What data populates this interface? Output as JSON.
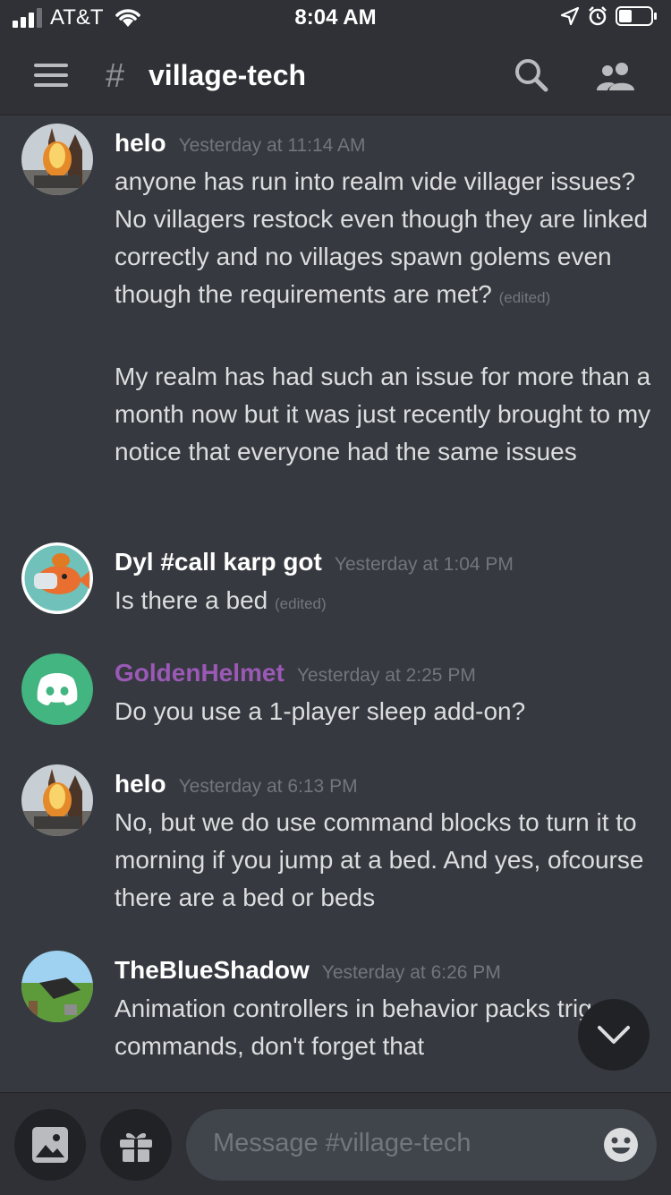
{
  "status_bar": {
    "carrier": "AT&T",
    "time": "8:04 AM"
  },
  "header": {
    "hash": "#",
    "channel_name": "village-tech"
  },
  "messages": [
    {
      "author": "helo",
      "timestamp": "Yesterday at 11:14 AM",
      "paragraphs": [
        {
          "text": "anyone has run into realm vide villager issues? No villagers restock even though they are linked correctly and no villages spawn golems even though the requirements are met?",
          "edited": "(edited)"
        },
        {
          "text": "My realm has had such an issue for more than a month now but it was just recently brought to my notice that everyone had the same issues"
        }
      ]
    },
    {
      "author": "Dyl #call karp got",
      "timestamp": "Yesterday at 1:04 PM",
      "paragraphs": [
        {
          "text": "Is there a bed",
          "edited": "(edited)"
        }
      ]
    },
    {
      "author": "GoldenHelmet",
      "timestamp": "Yesterday at 2:25 PM",
      "author_color": "#9b59b6",
      "paragraphs": [
        {
          "text": "Do you use a 1-player sleep add-on?"
        }
      ]
    },
    {
      "author": "helo",
      "timestamp": "Yesterday at 6:13 PM",
      "paragraphs": [
        {
          "text": "No, but we do use command blocks to turn it to morning if you jump at a bed. And yes, ofcourse there are a bed or beds"
        }
      ]
    },
    {
      "author": "TheBlueShadow",
      "timestamp": "Yesterday at 6:26 PM",
      "paragraphs": [
        {
          "text": "Animation controllers in behavior packs trigger commands, don't forget that"
        }
      ]
    }
  ],
  "composer": {
    "placeholder": "Message #village-tech"
  },
  "icons": [
    "signal-icon",
    "wifi-icon",
    "location-icon",
    "alarm-icon",
    "battery-icon",
    "menu-icon",
    "search-icon",
    "members-icon",
    "image-icon",
    "gift-icon",
    "emoji-icon",
    "chevron-down-icon",
    "discord-logo-icon"
  ],
  "colors": {
    "background": "#36393f",
    "header": "#2f3136",
    "accent_purple": "#9b59b6",
    "discord_green": "#43b581"
  }
}
